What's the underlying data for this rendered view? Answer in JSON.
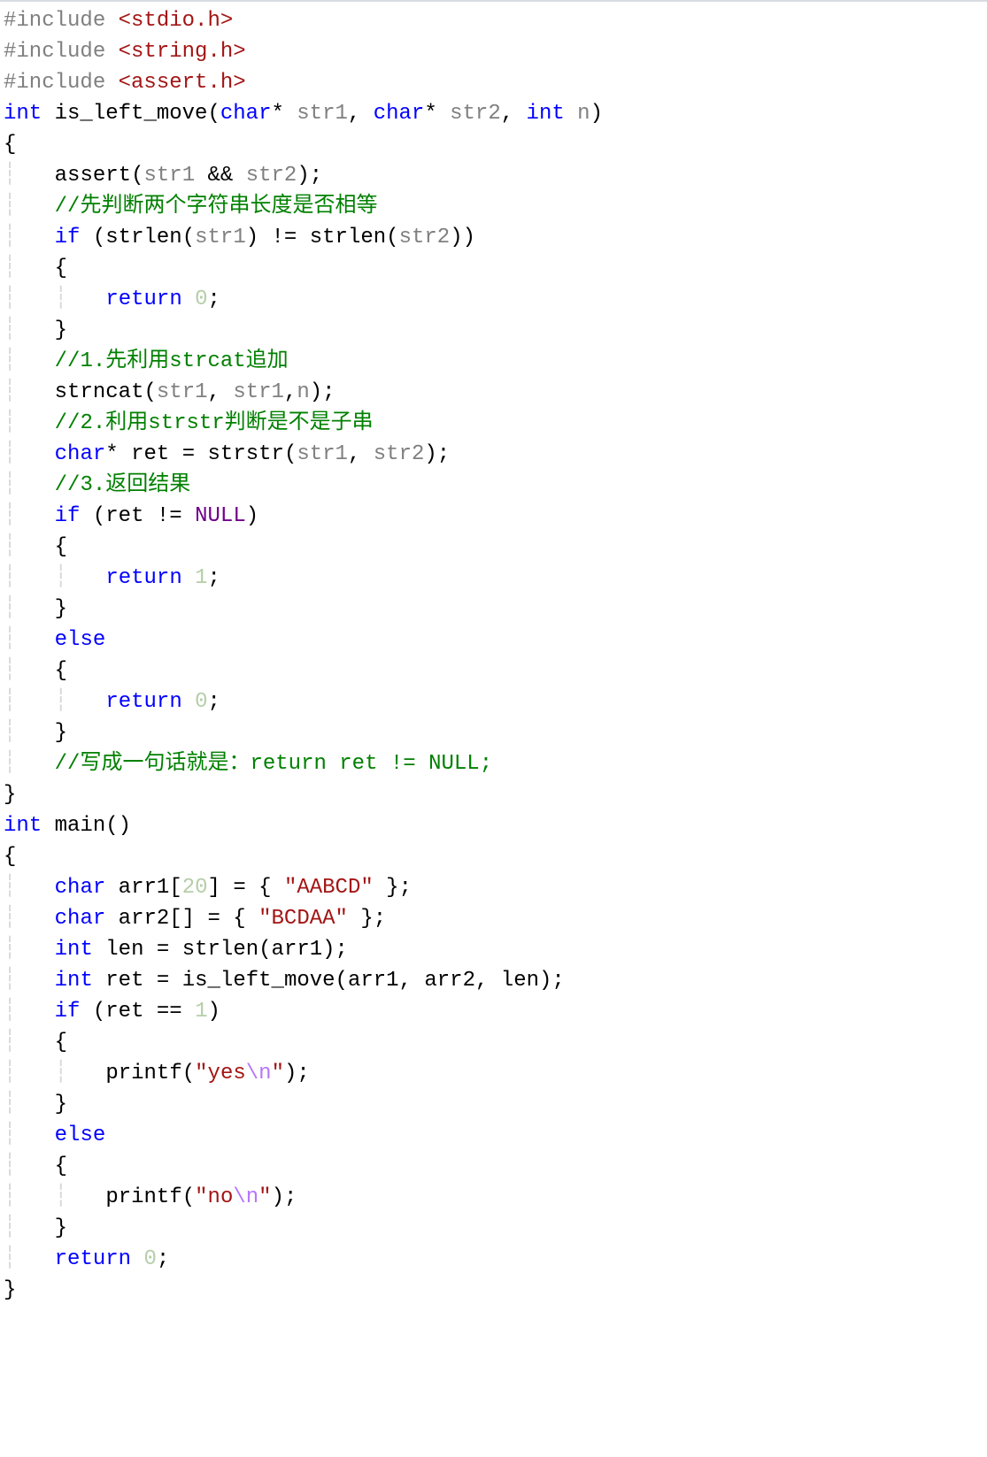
{
  "code": {
    "includes": [
      "stdio.h",
      "string.h",
      "assert.h"
    ],
    "func1": {
      "ret": "int",
      "name": "is_left_move",
      "params": [
        {
          "type": "char*",
          "name": "str1"
        },
        {
          "type": "char*",
          "name": "str2"
        },
        {
          "type": "int",
          "name": "n"
        }
      ],
      "lines": {
        "assert": "assert",
        "assert_args": "(str1 && str2);",
        "c1": "//先判断两个字符串长度是否相等",
        "if_strlen": "if (strlen(str1) != strlen(str2))",
        "ret0": "return 0;",
        "c2": "//1.先利用strcat追加",
        "strncat": "strncat(str1, str1,n);",
        "c3": "//2.利用strstr判断是不是子串",
        "decl_ret": "char* ret = strstr(str1, str2);",
        "c4": "//3.返回结果",
        "if_ret": "if (ret != NULL)",
        "ret1": "return 1;",
        "else": "else",
        "ret0b": "return 0;",
        "c5": "//写成一句话就是：return ret != NULL;"
      }
    },
    "main": {
      "ret": "int",
      "name": "main",
      "lines": {
        "arr1": "char arr1[20] = { \"AABCD\" };",
        "arr2": "char arr2[] = { \"BCDAA\" };",
        "len": "int len = strlen(arr1);",
        "ret": "int ret = is_left_move(arr1, arr2, len);",
        "if": "if (ret == 1)",
        "yes": "printf(\"yes\\n\");",
        "else": "else",
        "no": "printf(\"no\\n\");",
        "ret0": "return 0;"
      }
    }
  }
}
